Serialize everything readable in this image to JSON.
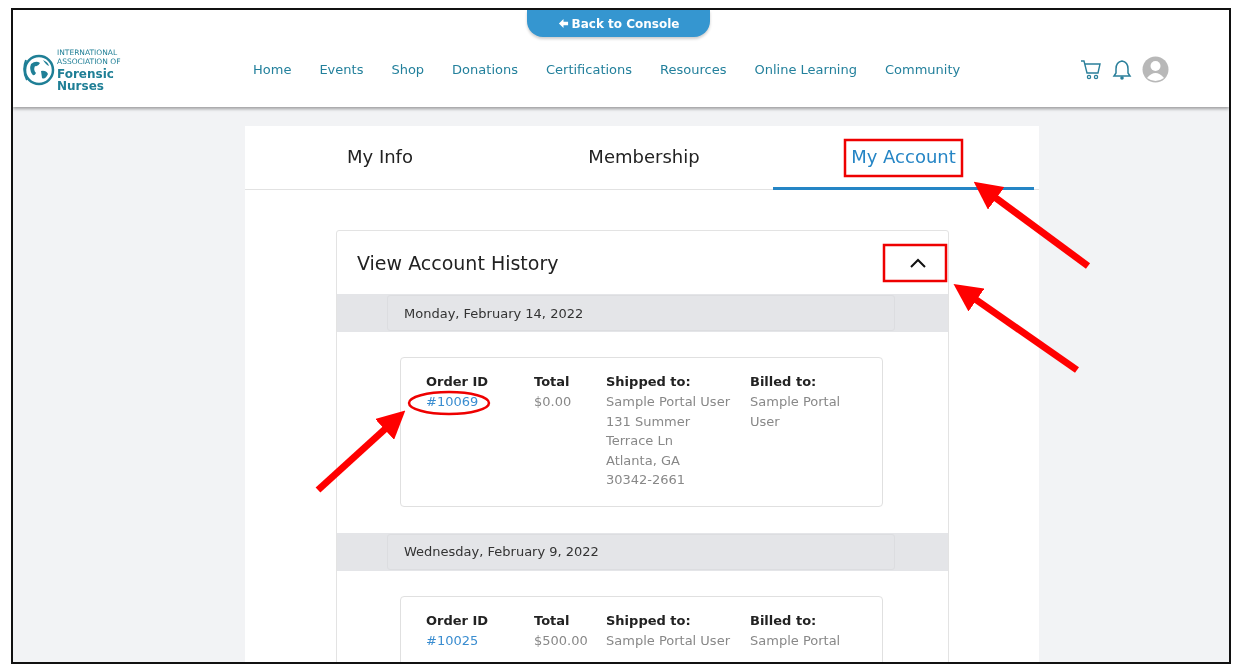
{
  "header": {
    "back_button": "Back to Console",
    "logo": {
      "small": "INTERNATIONAL ASSOCIATION OF",
      "large": "Forensic Nurses"
    },
    "nav": [
      "Home",
      "Events",
      "Shop",
      "Donations",
      "Certifications",
      "Resources",
      "Online Learning",
      "Community"
    ]
  },
  "tabs": [
    {
      "label": "My Info",
      "selected": false
    },
    {
      "label": "Membership",
      "selected": false
    },
    {
      "label": "My Account",
      "selected": true
    }
  ],
  "panel": {
    "title": "View Account History",
    "expanded": true,
    "groups": [
      {
        "date": "Monday, February 14, 2022",
        "order": {
          "headers": [
            "Order ID",
            "Total",
            "Shipped to:",
            "Billed to:"
          ],
          "order_id": "#10069",
          "total": "$0.00",
          "shipped_to": [
            "Sample Portal User",
            "131 Summer",
            "Terrace Ln",
            "Atlanta, GA",
            "30342-2661"
          ],
          "billed_to": [
            "Sample Portal",
            "User"
          ]
        }
      },
      {
        "date": "Wednesday, February 9, 2022",
        "order": {
          "headers": [
            "Order ID",
            "Total",
            "Shipped to:",
            "Billed to:"
          ],
          "order_id": "#10025",
          "total": "$500.00",
          "shipped_to": [
            "Sample Portal User"
          ],
          "billed_to": [
            "Sample Portal"
          ]
        }
      }
    ]
  }
}
